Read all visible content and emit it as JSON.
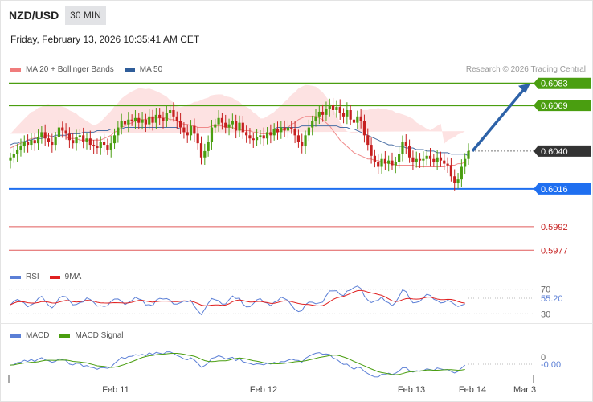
{
  "header": {
    "pair": "NZD/USD",
    "timeframe": "30 MIN",
    "datetime": "Friday, February 13, 2026 10:35:41 AM CET"
  },
  "legend_main": [
    {
      "label": "MA 20 + Bollinger Bands",
      "color": "#f07c7c"
    },
    {
      "label": "MA 50",
      "color": "#2f5d9a"
    }
  ],
  "credit": "Research © 2026 Trading Central",
  "legend_rsi": [
    {
      "label": "RSI",
      "color": "#5b7fd6"
    },
    {
      "label": "9MA",
      "color": "#e02020"
    }
  ],
  "legend_macd": [
    {
      "label": "MACD",
      "color": "#5b7fd6"
    },
    {
      "label": "MACD Signal",
      "color": "#4a9e10"
    }
  ],
  "colors": {
    "resistance": "#4a9e10",
    "support": "#1f6ff0",
    "support_faint": "#e05a5a",
    "current": "#333333",
    "up_candle": "#4a9e10",
    "down_candle": "#c62020",
    "bollinger_fill": "#fde2e2",
    "arrow": "#2d62a8"
  },
  "chart_data": {
    "type": "candlestick",
    "x_axis": {
      "ticks": [
        "Feb 11",
        "Feb 12",
        "Feb 13",
        "Feb 14",
        "Mar 3"
      ]
    },
    "price_range": [
      0.597,
      0.609
    ],
    "levels": [
      {
        "value": 0.6083,
        "label": "0.6083",
        "kind": "resistance"
      },
      {
        "value": 0.6069,
        "label": "0.6069",
        "kind": "resistance"
      },
      {
        "value": 0.604,
        "label": "0.6040",
        "kind": "current"
      },
      {
        "value": 0.6016,
        "label": "0.6016",
        "kind": "support"
      },
      {
        "value": 0.5992,
        "label": "0.5992",
        "kind": "support_faint"
      },
      {
        "value": 0.5977,
        "label": "0.5977",
        "kind": "support_faint"
      }
    ],
    "forecast": {
      "from": 0.604,
      "to": 0.6083
    },
    "close_series": [
      0.6036,
      0.6038,
      0.6041,
      0.6043,
      0.6046,
      0.6044,
      0.6047,
      0.6045,
      0.6049,
      0.6052,
      0.6048,
      0.6046,
      0.6044,
      0.6049,
      0.6055,
      0.6053,
      0.6051,
      0.6047,
      0.6045,
      0.6049,
      0.605,
      0.6046,
      0.6048,
      0.6044,
      0.6043,
      0.6042,
      0.6046,
      0.6044,
      0.6041,
      0.6045,
      0.605,
      0.6055,
      0.6059,
      0.6057,
      0.606,
      0.6059,
      0.6061,
      0.6058,
      0.606,
      0.6057,
      0.6062,
      0.6058,
      0.6063,
      0.6061,
      0.6059,
      0.6064,
      0.6066,
      0.6062,
      0.6059,
      0.6055,
      0.6052,
      0.605,
      0.6056,
      0.6051,
      0.6045,
      0.6036,
      0.604,
      0.6046,
      0.6055,
      0.6057,
      0.6061,
      0.6058,
      0.6055,
      0.6057,
      0.6059,
      0.6053,
      0.6058,
      0.6052,
      0.605,
      0.6048,
      0.6047,
      0.6049,
      0.605,
      0.6048,
      0.6052,
      0.605,
      0.6054,
      0.6052,
      0.6055,
      0.6053,
      0.6055,
      0.6054,
      0.605,
      0.6046,
      0.6043,
      0.605,
      0.6055,
      0.6059,
      0.6062,
      0.6065,
      0.6063,
      0.6067,
      0.6069,
      0.6066,
      0.6068,
      0.6064,
      0.6062,
      0.6066,
      0.606,
      0.6058,
      0.6062,
      0.6059,
      0.605,
      0.6044,
      0.6037,
      0.6033,
      0.603,
      0.6035,
      0.6032,
      0.6034,
      0.6031,
      0.6033,
      0.6038,
      0.6046,
      0.6043,
      0.6036,
      0.6033,
      0.6035,
      0.6034,
      0.6035,
      0.6037,
      0.6035,
      0.6033,
      0.6036,
      0.6034,
      0.6032,
      0.6031,
      0.6024,
      0.602,
      0.6022,
      0.603,
      0.6035,
      0.604
    ],
    "ma20_series": [
      0.6042,
      0.6043,
      0.6044,
      0.6045,
      0.6046,
      0.6047,
      0.6048,
      0.6048,
      0.6049,
      0.6049,
      0.605,
      0.605,
      0.6049,
      0.6049,
      0.6049,
      0.6049,
      0.6049,
      0.6048,
      0.6048,
      0.6048,
      0.6047,
      0.6047,
      0.6047,
      0.6047,
      0.6047,
      0.6047,
      0.6047,
      0.6048,
      0.6049,
      0.605,
      0.6052,
      0.6053,
      0.6055,
      0.6056,
      0.6057,
      0.6058,
      0.6059,
      0.606,
      0.606,
      0.606,
      0.6061,
      0.6061,
      0.6061,
      0.6061,
      0.6061,
      0.6061,
      0.606,
      0.606,
      0.6059,
      0.6058,
      0.6057,
      0.6057,
      0.6056,
      0.6056,
      0.6055,
      0.6055,
      0.6055,
      0.6055,
      0.6056,
      0.6056,
      0.6056,
      0.6056,
      0.6055,
      0.6055,
      0.6055,
      0.6054,
      0.6054,
      0.6053,
      0.6053,
      0.6053,
      0.6052,
      0.6052,
      0.6051,
      0.6051,
      0.6051,
      0.6051,
      0.6051,
      0.6052,
      0.6053,
      0.6054,
      0.6055,
      0.6057,
      0.6058,
      0.606,
      0.6061,
      0.6062,
      0.6062,
      0.6062,
      0.6062,
      0.6061,
      0.606,
      0.6058,
      0.6056,
      0.6053,
      0.605,
      0.6047,
      0.6045,
      0.6043,
      0.6041,
      0.6039,
      0.6038,
      0.6037,
      0.6036,
      0.6035,
      0.6035,
      0.6034,
      0.6034,
      0.6033,
      0.6033,
      0.6032,
      0.6032,
      0.6031,
      0.6031,
      0.6031,
      0.6031,
      0.6031,
      0.6031,
      0.603,
      0.603,
      0.603,
      0.603,
      0.603,
      0.603,
      0.603,
      0.603,
      0.603,
      0.6031,
      0.6031,
      0.6031,
      0.6032,
      0.6032,
      0.6033
    ],
    "ma50_series": [
      0.6044,
      0.6045,
      0.6045,
      0.6046,
      0.6046,
      0.6047,
      0.6047,
      0.6048,
      0.6048,
      0.6048,
      0.6049,
      0.6049,
      0.6049,
      0.605,
      0.605,
      0.605,
      0.605,
      0.6051,
      0.6051,
      0.6051,
      0.6051,
      0.6052,
      0.6052,
      0.6052,
      0.6052,
      0.6053,
      0.6053,
      0.6053,
      0.6053,
      0.6054,
      0.6054,
      0.6054,
      0.6054,
      0.6055,
      0.6055,
      0.6055,
      0.6055,
      0.6055,
      0.6055,
      0.6055,
      0.6055,
      0.6055,
      0.6055,
      0.6055,
      0.6055,
      0.6055,
      0.6055,
      0.6055,
      0.6055,
      0.6054,
      0.6054,
      0.6054,
      0.6054,
      0.6054,
      0.6054,
      0.6054,
      0.6054,
      0.6054,
      0.6054,
      0.6054,
      0.6054,
      0.6054,
      0.6054,
      0.6054,
      0.6054,
      0.6054,
      0.6054,
      0.6054,
      0.6054,
      0.6054,
      0.6054,
      0.6054,
      0.6054,
      0.6054,
      0.6054,
      0.6054,
      0.6054,
      0.6055,
      0.6055,
      0.6055,
      0.6055,
      0.6055,
      0.6055,
      0.6055,
      0.6056,
      0.6056,
      0.6056,
      0.6056,
      0.6056,
      0.6056,
      0.6056,
      0.6056,
      0.6056,
      0.6056,
      0.6056,
      0.6055,
      0.6055,
      0.6055,
      0.6054,
      0.6054,
      0.6053,
      0.6052,
      0.6051,
      0.605,
      0.6049,
      0.6048,
      0.6047,
      0.6046,
      0.6045,
      0.6044,
      0.6044,
      0.6043,
      0.6043,
      0.6043,
      0.6042,
      0.6042,
      0.6042,
      0.6041,
      0.6041,
      0.6041,
      0.604,
      0.604,
      0.604,
      0.6039,
      0.6039,
      0.6039,
      0.6039,
      0.6038,
      0.6038,
      0.6038,
      0.6038,
      0.6038,
      0.6037
    ],
    "rsi": {
      "levels": [
        {
          "value": 70,
          "label": "70"
        },
        {
          "value": 30,
          "label": "30"
        }
      ],
      "current": {
        "value": 55.2,
        "label": "55.20"
      },
      "range": [
        20,
        80
      ]
    },
    "macd": {
      "zero_label": "0",
      "current": {
        "value": -0.0,
        "label": "-0.00"
      }
    }
  }
}
